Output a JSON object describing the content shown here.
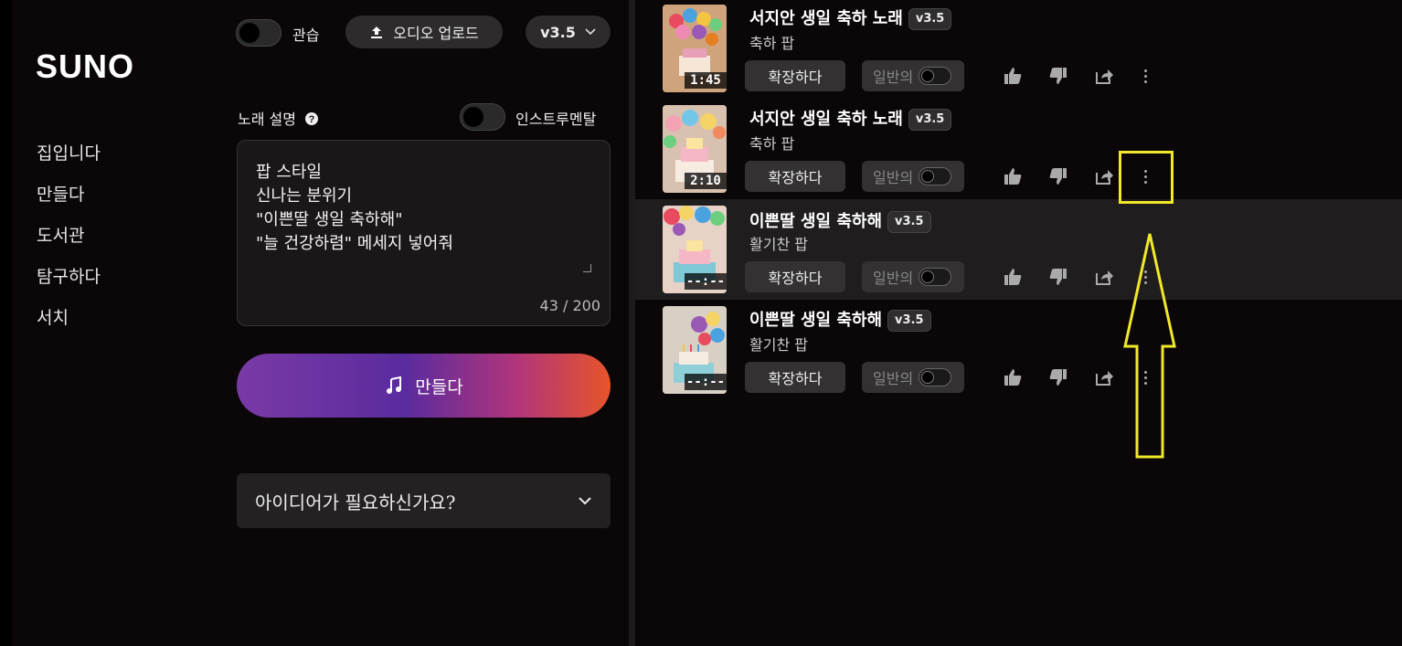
{
  "brand": "SUNO",
  "nav": [
    "집입니다",
    "만들다",
    "도서관",
    "탐구하다",
    "서치"
  ],
  "create": {
    "practice_label": "관습",
    "upload_label": "오디오 업로드",
    "version_selected": "v3.5",
    "description_label": "노래 설명",
    "instrumental_label": "인스트루멘탈",
    "prompt_lines": [
      "팝 스타일",
      "신나는 분위기",
      "\"이쁜딸 생일 축하해\"",
      "\"늘 건강하렴\" 메세지 넣어줘"
    ],
    "char_count": "43 / 200",
    "create_button": "만들다",
    "ideas_label": "아이디어가 필요하신가요?"
  },
  "songs": [
    {
      "title": "서지안 생일 축하 노래",
      "version": "v3.5",
      "style": "축하 팝",
      "duration": "1:45",
      "extend": "확장하다",
      "public": "일반의"
    },
    {
      "title": "서지안 생일 축하 노래",
      "version": "v3.5",
      "style": "축하 팝",
      "duration": "2:10",
      "extend": "확장하다",
      "public": "일반의"
    },
    {
      "title": "이쁜딸 생일 축하해",
      "version": "v3.5",
      "style": "활기찬 팝",
      "duration": "--:--",
      "extend": "확장하다",
      "public": "일반의"
    },
    {
      "title": "이쁜딸 생일 축하해",
      "version": "v3.5",
      "style": "활기찬 팝",
      "duration": "--:--",
      "extend": "확장하다",
      "public": "일반의"
    }
  ],
  "colors": {
    "accent_annotation": "#f2e82a",
    "create_gradient_start": "#7a3aa6",
    "create_gradient_end": "#e7552a"
  }
}
